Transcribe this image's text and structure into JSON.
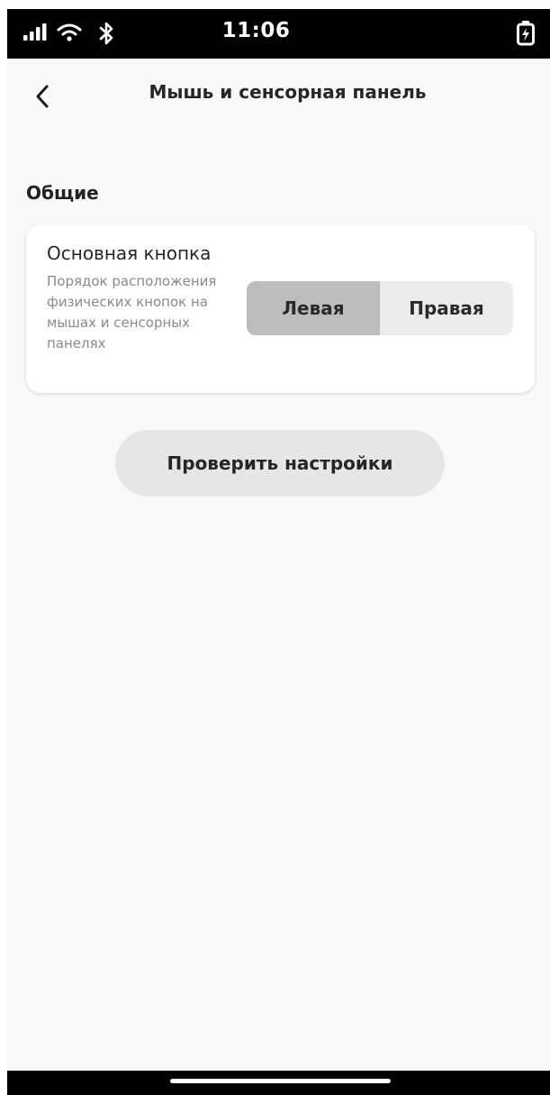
{
  "status_bar": {
    "time": "11:06",
    "icons": [
      "signal-icon",
      "wifi-icon",
      "bluetooth-icon",
      "battery-charging-icon"
    ]
  },
  "header": {
    "title": "Мышь и сенсорная панель",
    "back_icon": "chevron-left-icon"
  },
  "section": {
    "title": "Общие"
  },
  "primary_button_setting": {
    "title": "Основная кнопка",
    "description": "Порядок расположения физических кнопок на мышах и сенсорных панелях",
    "options": [
      "Левая",
      "Правая"
    ],
    "selected": "Левая"
  },
  "check_settings_button": {
    "label": "Проверить настройки"
  },
  "colors": {
    "background": "#f9f9f9",
    "selected_segment": "#bdbdbd",
    "unselected_segment": "#ececec",
    "button": "#e6e6e6"
  }
}
